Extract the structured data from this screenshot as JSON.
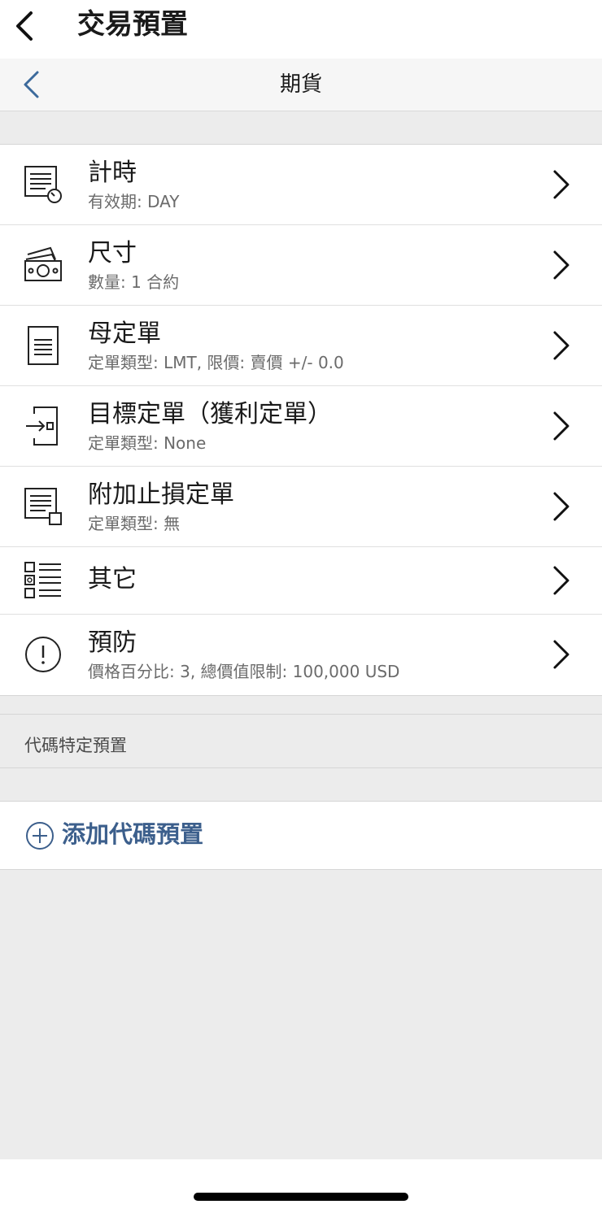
{
  "header": {
    "title": "交易預置"
  },
  "subheader": {
    "title": "期貨"
  },
  "settings": [
    {
      "label": "計時",
      "sub": "有效期: DAY",
      "icon": "timer-list-icon"
    },
    {
      "label": "尺寸",
      "sub": "數量: 1 合約",
      "icon": "money-bills-icon"
    },
    {
      "label": "母定單",
      "sub": "定單類型: LMT, 限價: 賣價 +/- 0.0",
      "icon": "document-list-icon"
    },
    {
      "label": "目標定單（獲利定單）",
      "sub": "定單類型: None",
      "icon": "target-order-icon"
    },
    {
      "label": "附加止損定單",
      "sub": "定單類型: 無",
      "icon": "stop-loss-list-icon"
    },
    {
      "label": "其它",
      "sub": "",
      "icon": "misc-list-icon"
    },
    {
      "label": "預防",
      "sub": "價格百分比: 3, 總價值限制: 100,000 USD",
      "icon": "exclamation-circle-icon"
    }
  ],
  "section": {
    "title": "代碼特定預置"
  },
  "add": {
    "label": "添加代碼預置"
  },
  "colors": {
    "accent": "#3c5f8c",
    "background": "#ececec",
    "text": "#1a1a1a",
    "subtext": "#6b6b6b"
  }
}
